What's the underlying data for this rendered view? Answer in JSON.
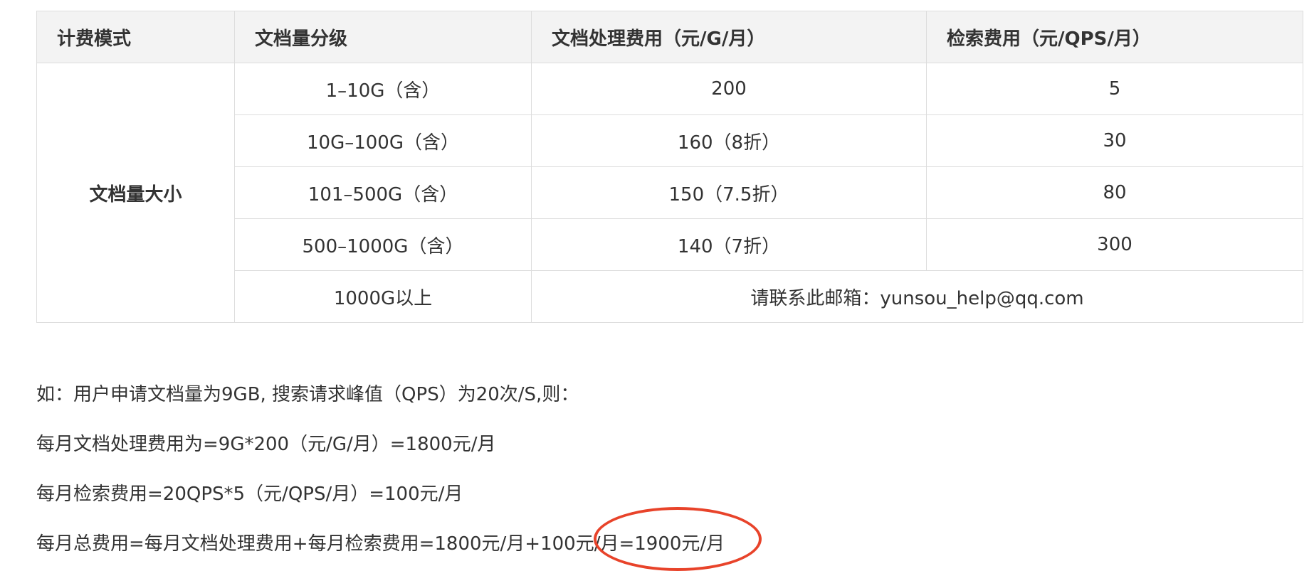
{
  "table": {
    "headers": [
      "计费模式",
      "文档量分级",
      "文档处理费用（元/G/月）",
      "检索费用（元/QPS/月）"
    ],
    "billing_mode": "文档量大小",
    "rows": [
      {
        "tier": "1–10G（含）",
        "doc_fee": "200",
        "search_fee": "5"
      },
      {
        "tier": "10G–100G（含）",
        "doc_fee": "160（8折）",
        "search_fee": "30"
      },
      {
        "tier": "101–500G（含）",
        "doc_fee": "150（7.5折）",
        "search_fee": "80"
      },
      {
        "tier": "500–1000G（含）",
        "doc_fee": "140（7折）",
        "search_fee": "300"
      }
    ],
    "last_row": {
      "tier": "1000G以上",
      "contact": "请联系此邮箱：yunsou_help@qq.com"
    }
  },
  "examples": {
    "intro": "如：用户申请文档量为9GB, 搜索请求峰值（QPS）为20次/S,则：",
    "doc_calc": "每月文档处理费用为=9G*200（元/G/月）=1800元/月",
    "search_calc": "每月检索费用=20QPS*5（元/QPS/月）=100元/月",
    "total_calc": "每月总费用=每月文档处理费用+每月检索费用=1800元/月+100元/月=1900元/月"
  },
  "colors": {
    "header_bg": "#f3f3f3",
    "border": "#dddddd",
    "text": "#333333",
    "highlight": "#e8432a"
  }
}
